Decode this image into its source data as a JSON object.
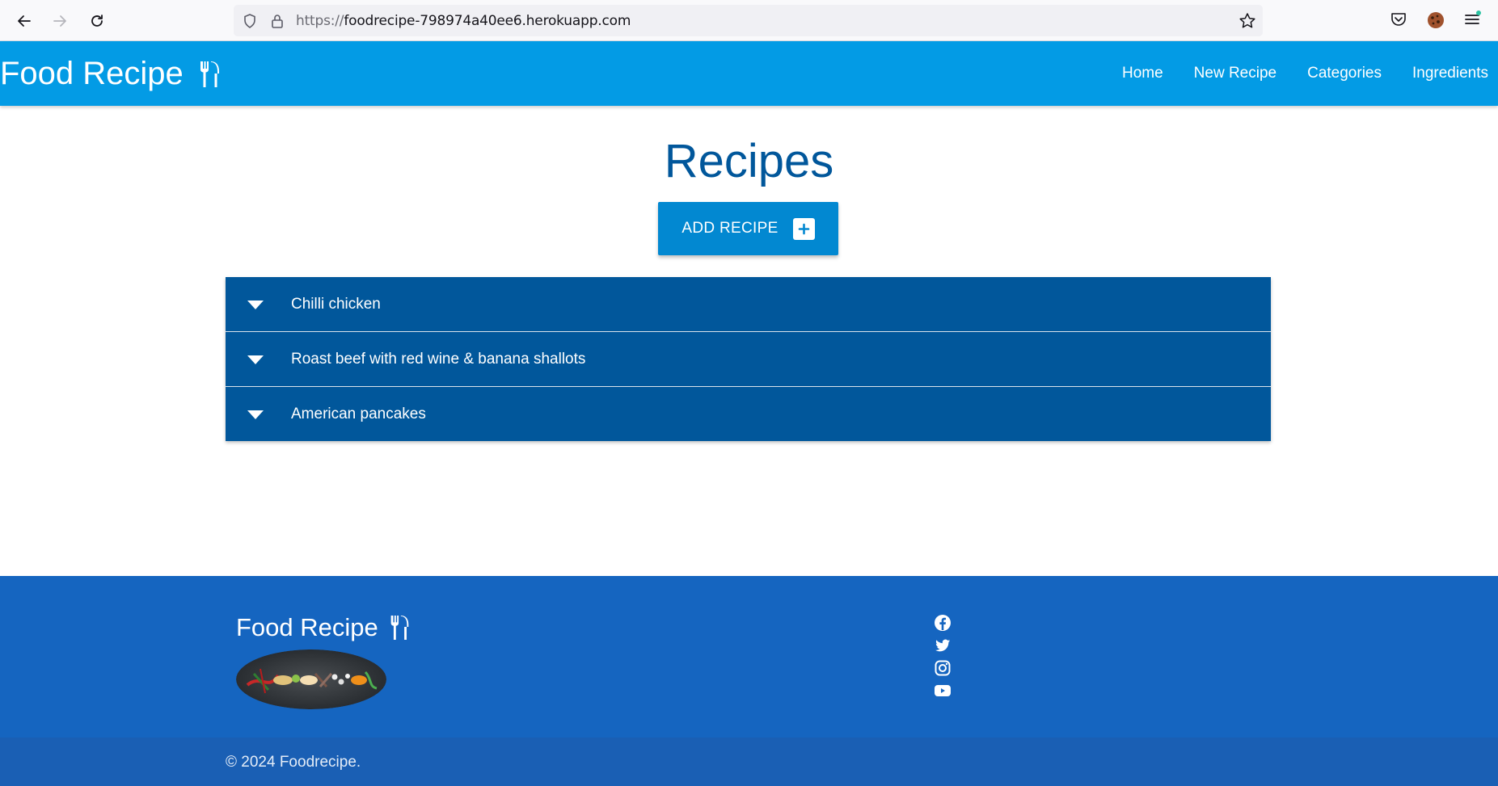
{
  "browser": {
    "url_protocol": "https://",
    "url_host": "foodrecipe-798974a40ee6.herokuapp.com",
    "icons": [
      "back-icon",
      "forward-icon",
      "reload-icon",
      "shield-icon",
      "lock-icon",
      "bookmark-star-icon",
      "pocket-icon",
      "cookie-icon",
      "menu-icon"
    ]
  },
  "navbar": {
    "brand": "Food Recipe",
    "brand_icon": "utensils-icon",
    "links": [
      "Home",
      "New Recipe",
      "Categories",
      "Ingredients"
    ]
  },
  "main": {
    "title": "Recipes",
    "add_button_label": "ADD RECIPE",
    "add_button_icon": "plus-square-icon",
    "recipes": [
      {
        "name": "Chilli chicken"
      },
      {
        "name": "Roast beef with red wine & banana shallots"
      },
      {
        "name": "American pancakes"
      }
    ]
  },
  "footer": {
    "brand": "Food Recipe",
    "social_icons": [
      "facebook-icon",
      "twitter-icon",
      "instagram-icon",
      "youtube-icon"
    ],
    "copyright": "© 2024 Foodrecipe."
  },
  "colors": {
    "navbar": "#039be5",
    "title": "#01579b",
    "button": "#0288d1",
    "recipe_row": "#01579b",
    "footer": "#1565c0",
    "footer_bottom": "#1a5fb4"
  }
}
